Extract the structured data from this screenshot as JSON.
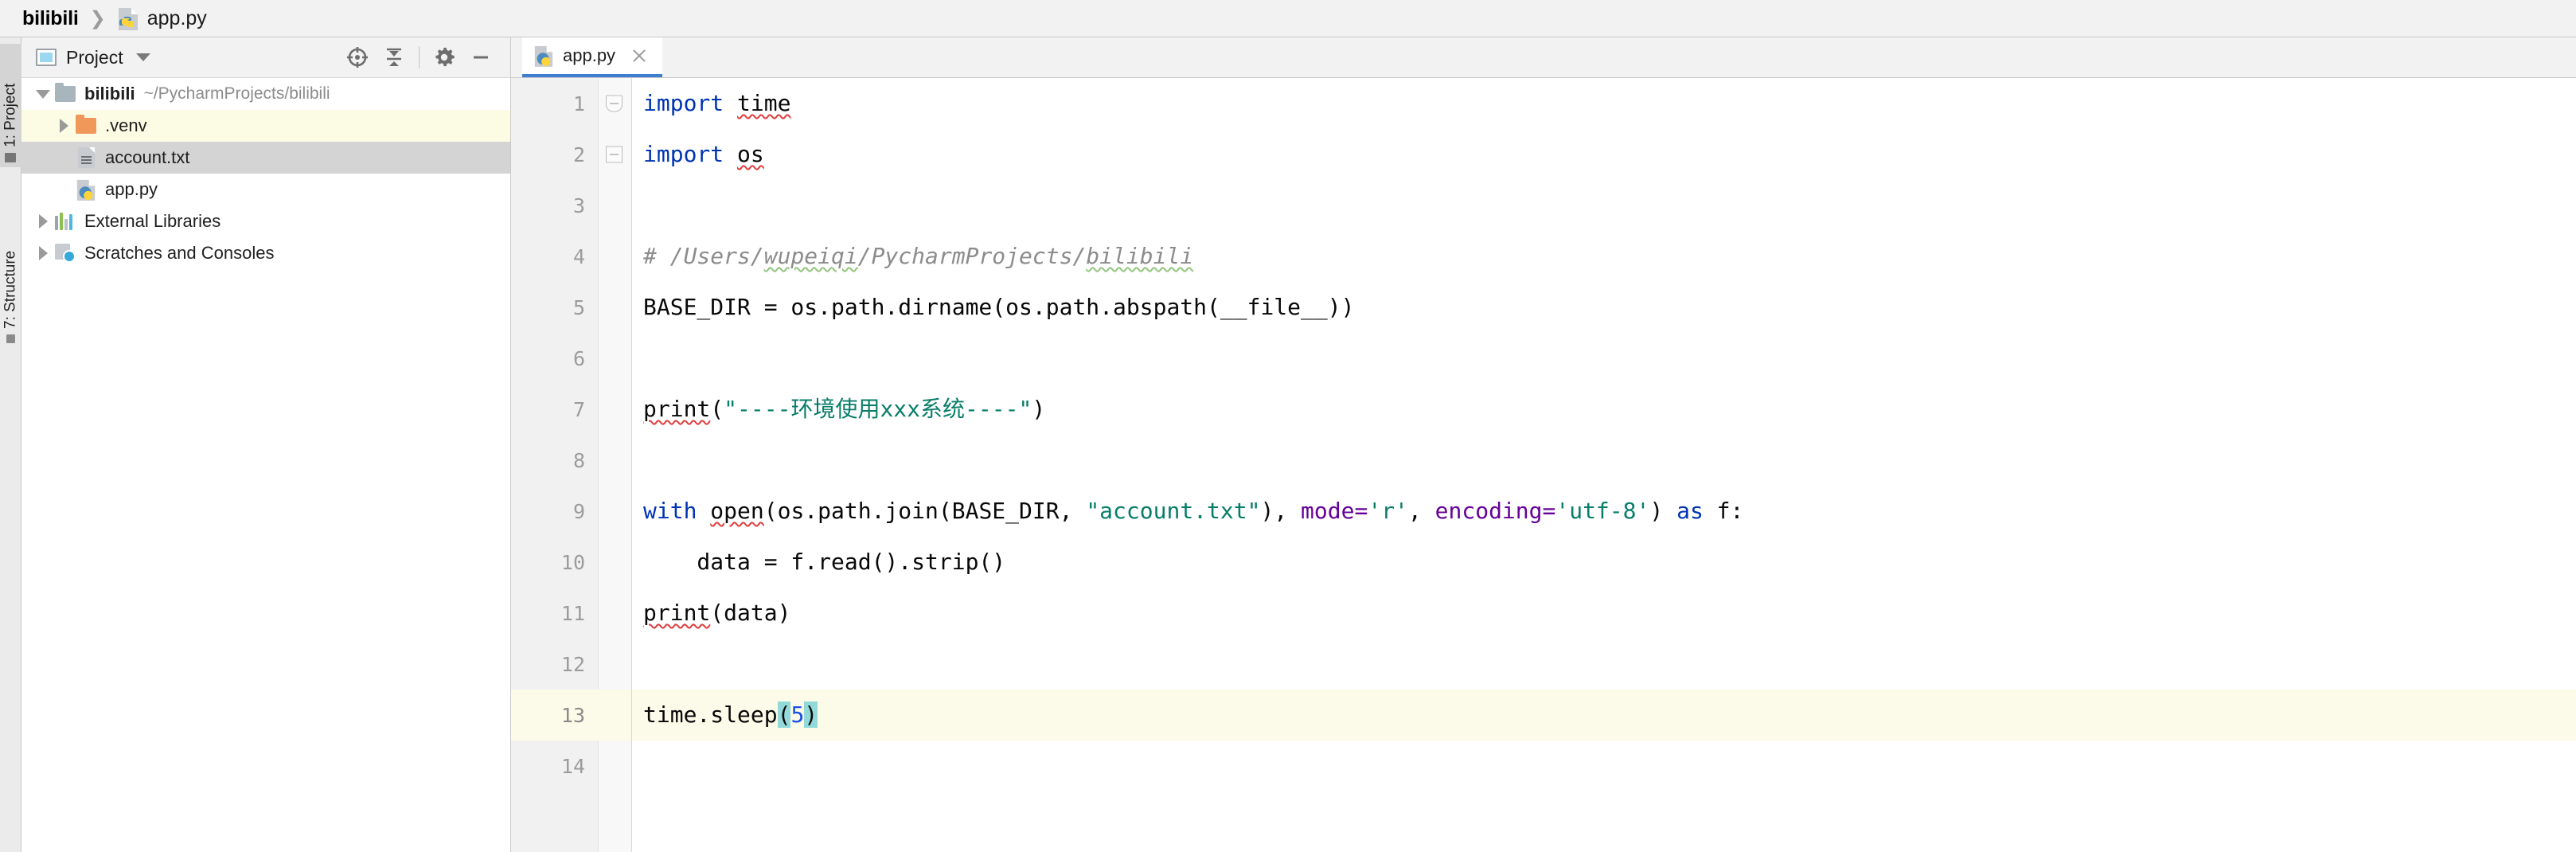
{
  "breadcrumb": {
    "project": "bilibili",
    "separator": "❯",
    "file": "app.py",
    "file_icon": "python-file-icon"
  },
  "left_tool_strip": {
    "tabs": [
      {
        "label": "1: Project",
        "icon": "project-folder-icon",
        "active": true
      },
      {
        "label": "7: Structure",
        "icon": "structure-icon",
        "active": false
      }
    ]
  },
  "project_panel": {
    "title": "Project",
    "title_icon": "project-window-icon",
    "dropdown_icon": "chevron-down-icon",
    "toolbar": [
      {
        "name": "select-opened-file-button",
        "icon": "crosshair-target-icon"
      },
      {
        "name": "collapse-all-button",
        "icon": "collapse-all-icon"
      },
      {
        "name": "settings-button",
        "icon": "gear-icon"
      },
      {
        "name": "hide-button",
        "icon": "minimize-icon"
      }
    ],
    "tree": [
      {
        "label": "bilibili",
        "path": "~/PycharmProjects/bilibili",
        "icon": "folder-gray-icon",
        "arrow": "down",
        "indent": 0,
        "bold": true,
        "selected": "none"
      },
      {
        "label": ".venv",
        "path": "",
        "icon": "folder-orange-icon",
        "arrow": "right",
        "indent": 1,
        "bold": false,
        "selected": "yellow"
      },
      {
        "label": "account.txt",
        "path": "",
        "icon": "text-file-icon",
        "arrow": "none",
        "indent": 2,
        "bold": false,
        "selected": "gray"
      },
      {
        "label": "app.py",
        "path": "",
        "icon": "python-file-icon",
        "arrow": "none",
        "indent": 2,
        "bold": false,
        "selected": "none"
      },
      {
        "label": "External Libraries",
        "path": "",
        "icon": "external-libraries-icon",
        "arrow": "right",
        "indent": 0,
        "bold": false,
        "selected": "none"
      },
      {
        "label": "Scratches and Consoles",
        "path": "",
        "icon": "scratches-icon",
        "arrow": "right",
        "indent": 0,
        "bold": false,
        "selected": "none"
      }
    ]
  },
  "editor": {
    "tabs": [
      {
        "label": "app.py",
        "icon": "python-file-icon",
        "active": true,
        "close_icon": "close-icon"
      }
    ],
    "line_numbers": [
      "1",
      "2",
      "3",
      "4",
      "5",
      "6",
      "7",
      "8",
      "9",
      "10",
      "11",
      "12",
      "13",
      "14"
    ],
    "current_line": 13,
    "code": {
      "l1": "import time",
      "l2": "import os",
      "l3": "",
      "l4": "# /Users/wupeiqi/PycharmProjects/bilibili",
      "l5": "BASE_DIR = os.path.dirname(os.path.abspath(__file__))",
      "l6": "",
      "l7": "print(\"----环境使用xxx系统----\")",
      "l8": "",
      "l9": "with open(os.path.join(BASE_DIR, \"account.txt\"), mode='r', encoding='utf-8') as f:",
      "l10": "    data = f.read().strip()",
      "l11": "print(data)",
      "l12": "",
      "l13": "time.sleep(5)",
      "l14": ""
    },
    "tokens": {
      "kw_import": "import",
      "mod_time": "time",
      "mod_os": "os",
      "comment_l4": "# /Users/wupeiqi/PycharmProjects/bilibili",
      "comment_l4_a": "# /Users/",
      "comment_l4_b": "wupeiqi",
      "comment_l4_c": "/PycharmProjects/",
      "comment_l4_d": "bilibili",
      "l5_text": "BASE_DIR = os.path.dirname(os.path.abspath(__file__))",
      "l7_print": "print",
      "l7_open_paren": "(",
      "l7_string": "\"----环境使用xxx系统----\"",
      "l7_close_paren": ")",
      "l9_with": "with",
      "l9_open": "open",
      "l9_mid": "(os.path.join(BASE_DIR, ",
      "l9_str_account": "\"account.txt\"",
      "l9_after_str": "), ",
      "l9_mode_kw": "mode",
      "l9_eq1": "=",
      "l9_mode_val": "'r'",
      "l9_comma": ", ",
      "l9_encoding_kw": "encoding",
      "l9_eq2": "=",
      "l9_encoding_val": "'utf-8'",
      "l9_close": ")",
      "l9_as": "as",
      "l9_f": " f:",
      "l10_text": "    data = f.read().strip()",
      "l11_print": "print",
      "l11_rest": "(data)",
      "l13_a": "time.sleep",
      "l13_lparen": "(",
      "l13_num": "5",
      "l13_rparen": ")"
    }
  },
  "colors": {
    "keyword": "#0033b3",
    "string": "#067d68",
    "number": "#1750eb",
    "comment": "#8c8c8c",
    "named_arg": "#660099",
    "bracket_match": "#93d9d9",
    "caret_row": "#fcfae8",
    "tab_underline": "#3c7fd0",
    "tree_selection_yellow": "#fcfbe3",
    "tree_selection_gray": "#d4d4d4",
    "error_squiggle": "#e03d3d",
    "typo_squiggle": "#93c47d"
  }
}
